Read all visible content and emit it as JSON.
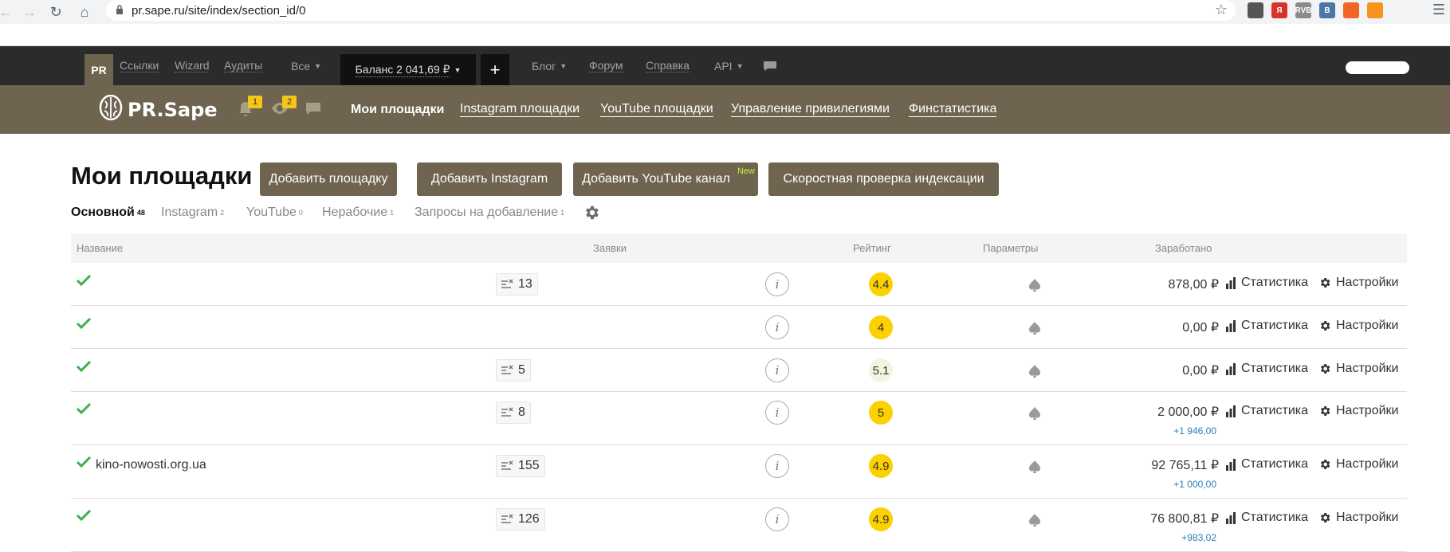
{
  "browser": {
    "url": "pr.sape.ru/site/index/section_id/0",
    "extensions": [
      {
        "name": "ext-1",
        "label": "",
        "color": "#555555"
      },
      {
        "name": "yandex",
        "label": "Я",
        "color": "#d9322b"
      },
      {
        "name": "rvb",
        "label": "RVB",
        "color": "#8a8a8a"
      },
      {
        "name": "vk",
        "label": "В",
        "color": "#4a76a8"
      },
      {
        "name": "rss",
        "label": "",
        "color": "#f26522"
      },
      {
        "name": "ok",
        "label": "",
        "color": "#f7931e"
      }
    ]
  },
  "topbar": {
    "pr": "PR",
    "links": "Ссылки",
    "wizard": "Wizard",
    "audits": "Аудиты",
    "all": "Все",
    "balance": "Баланс  2 041,69 ₽",
    "plus": "+",
    "blog": "Блог",
    "forum": "Форум",
    "help": "Справка",
    "api": "API"
  },
  "brand": {
    "name": "PR.Sape",
    "notifications": "1",
    "views": "2"
  },
  "mainnav": {
    "my_sites": "Мои площадки",
    "instagram": "Instagram площадки",
    "youtube": "YouTube площадки",
    "privileges": "Управление привилегиями",
    "finstat": "Финстатистика"
  },
  "page": {
    "title": "Мои площадки",
    "btn_add_site": "Добавить площадку",
    "btn_add_instagram": "Добавить Instagram",
    "btn_add_youtube": "Добавить YouTube канал",
    "new_label": "New",
    "btn_index_check": "Скоростная проверка индексации"
  },
  "subtabs": [
    {
      "label": "Основной",
      "count": "48"
    },
    {
      "label": "Instagram",
      "count": "2"
    },
    {
      "label": "YouTube",
      "count": "0"
    },
    {
      "label": "Нерабочие",
      "count": "1"
    },
    {
      "label": "Запросы на добавление",
      "count": "1"
    }
  ],
  "table": {
    "headers": {
      "name": "Название",
      "requests": "Заявки",
      "rating": "Рейтинг",
      "params": "Параметры",
      "earned": "Заработано"
    },
    "info_glyph": "i",
    "stat_label": "Статистика",
    "settings_label": "Настройки",
    "rows": [
      {
        "name": "",
        "requests": "13",
        "rating": "4.4",
        "earned": "878,00 ₽",
        "delta": ""
      },
      {
        "name": "",
        "requests": "",
        "rating": "4",
        "earned": "0,00 ₽",
        "delta": ""
      },
      {
        "name": "",
        "requests": "5",
        "rating": "5.1",
        "earned": "0,00 ₽",
        "delta": ""
      },
      {
        "name": "",
        "requests": "8",
        "rating": "5",
        "earned": "2 000,00 ₽",
        "delta": "+1 946,00"
      },
      {
        "name": "kino-nowosti.org.ua",
        "requests": "155",
        "rating": "4.9",
        "earned": "92 765,11 ₽",
        "delta": "+1 000,00"
      },
      {
        "name": "",
        "requests": "126",
        "rating": "4.9",
        "earned": "76 800,81 ₽",
        "delta": "+983,02"
      }
    ]
  },
  "colors": {
    "brand_brown": "#6e6450",
    "topbar_dark": "#2b2b2b",
    "rating_yellow": "#fdd000",
    "check_green": "#3cb44b",
    "delta_blue": "#2a7fb3"
  }
}
